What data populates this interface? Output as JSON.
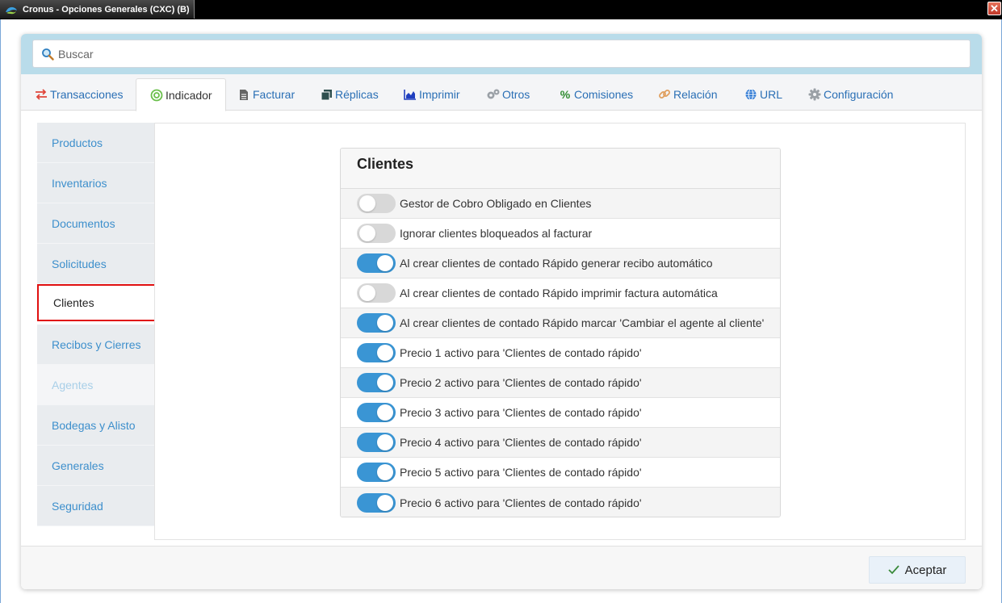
{
  "window": {
    "title": "Cronus - Opciones Generales (CXC) (B)",
    "close_glyph": "✕",
    "icon": "cronus-logo-icon"
  },
  "search": {
    "placeholder": "Buscar",
    "value": ""
  },
  "tabs": [
    {
      "label": "Transacciones",
      "icon": "arrows-exchange-icon",
      "color": "#e0463b"
    },
    {
      "label": "Indicador",
      "icon": "target-icon",
      "color": "#6abf4b",
      "active": true
    },
    {
      "label": "Facturar",
      "icon": "document-icon",
      "color": "#555555"
    },
    {
      "label": "Réplicas",
      "icon": "copy-icon",
      "color": "#2f4f4f"
    },
    {
      "label": "Imprimir",
      "icon": "area-chart-icon",
      "color": "#1f3fbf"
    },
    {
      "label": "Otros",
      "icon": "gears-icon",
      "color": "#9aa0a6"
    },
    {
      "label": "Comisiones",
      "icon": "percent-icon",
      "color": "#2e8b2e"
    },
    {
      "label": "Relación",
      "icon": "link-icon",
      "color": "#e0a060"
    },
    {
      "label": "URL",
      "icon": "globe-icon",
      "color": "#1f6fd1"
    },
    {
      "label": "Configuración",
      "icon": "gear-icon",
      "color": "#9aa0a6"
    }
  ],
  "sidebar": {
    "items": [
      {
        "label": "Productos"
      },
      {
        "label": "Inventarios"
      },
      {
        "label": "Documentos"
      },
      {
        "label": "Solicitudes"
      },
      {
        "label": "Clientes",
        "active": true
      },
      {
        "label": "Recibos y Cierres"
      },
      {
        "label": "Agentes",
        "disabled": true
      },
      {
        "label": "Bodegas y Alisto"
      },
      {
        "label": "Generales"
      },
      {
        "label": "Seguridad"
      }
    ]
  },
  "card": {
    "title": "Clientes",
    "options": [
      {
        "label": "Gestor de Cobro Obligado en Clientes",
        "on": false
      },
      {
        "label": "Ignorar clientes bloqueados al facturar",
        "on": false
      },
      {
        "label": "Al crear clientes de contado Rápido generar recibo automático",
        "on": true
      },
      {
        "label": "Al crear clientes de contado Rápido imprimir factura automática",
        "on": false
      },
      {
        "label": "Al crear clientes de contado Rápido marcar 'Cambiar el agente al cliente'",
        "on": true
      },
      {
        "label": "Precio 1 activo para 'Clientes de contado rápido'",
        "on": true
      },
      {
        "label": "Precio 2 activo para 'Clientes de contado rápido'",
        "on": true
      },
      {
        "label": "Precio 3 activo para 'Clientes de contado rápido'",
        "on": true
      },
      {
        "label": "Precio 4 activo para 'Clientes de contado rápido'",
        "on": true
      },
      {
        "label": "Precio 5 activo para 'Clientes de contado rápido'",
        "on": true
      },
      {
        "label": "Precio 6 activo para 'Clientes de contado rápido'",
        "on": true
      }
    ]
  },
  "footer": {
    "accept_label": "Aceptar"
  },
  "colors": {
    "toggle_on": "#3a95d4",
    "toggle_off": "#d8d8d8",
    "link": "#3d8fcc",
    "active_border": "#e01010",
    "search_band": "#b9dcea"
  }
}
